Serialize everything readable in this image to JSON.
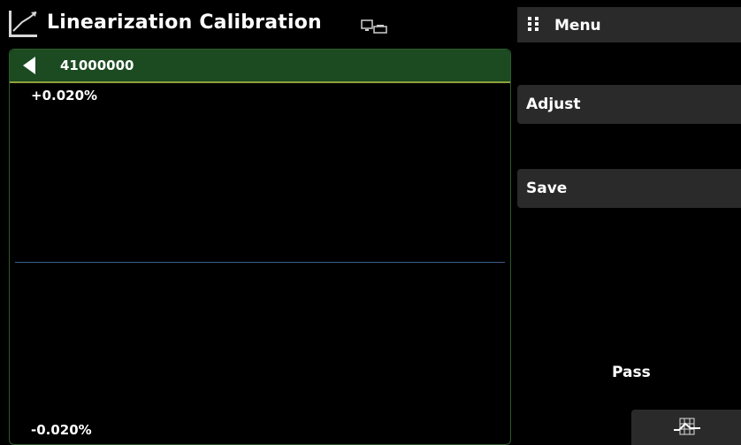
{
  "header": {
    "title": "Linearization Calibration",
    "left_icon": "linearization-chart-icon",
    "device_icon": "device-screen-icon"
  },
  "menu": {
    "label": "Menu",
    "icon": "grid-dots-icon"
  },
  "panel": {
    "title": "41000000",
    "back_icon": "back-arrow-icon",
    "y_max_label": "+0.020%",
    "y_min_label": "-0.020%"
  },
  "actions": {
    "adjust_label": "Adjust",
    "save_label": "Save"
  },
  "status": {
    "text": "Pass"
  },
  "bottom": {
    "chart_icon": "table-chart-icon"
  },
  "colors": {
    "background": "#000000",
    "header_green": "#1c4b22",
    "accent_line": "#8fa23a",
    "zero_line": "#3d5d8f",
    "button_gray": "#2a2a2a"
  }
}
